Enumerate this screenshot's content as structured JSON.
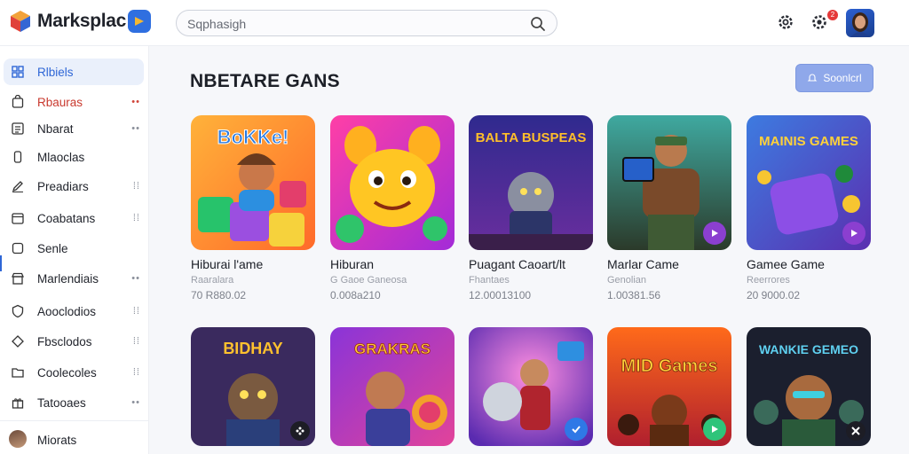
{
  "app": {
    "name": "Marksplac",
    "colors": {
      "accent": "#2e66d6",
      "alert": "#c9392e",
      "cta": "#8fa8ea"
    }
  },
  "search": {
    "placeholder": "Sqphasigh"
  },
  "header": {
    "notification_count": "2",
    "icons": [
      "settings-icon",
      "gear-icon",
      "avatar"
    ]
  },
  "sidebar": {
    "items": [
      {
        "label": "Rlbiels",
        "icon": "grid-icon",
        "active": true,
        "dots": ""
      },
      {
        "label": "Rbauras",
        "icon": "bag-icon",
        "active": false,
        "dots": "••",
        "alert": true
      },
      {
        "label": "Nbarat",
        "icon": "list-icon",
        "active": false,
        "dots": "••"
      },
      {
        "label": "Mlaoclas",
        "icon": "device-icon",
        "active": false,
        "dots": ""
      },
      {
        "label": "Preadiars",
        "icon": "pencil-icon",
        "active": false,
        "dots": "⁞⁞"
      },
      {
        "label": "Coabatans",
        "icon": "calendar-icon",
        "active": false,
        "dots": "⁞⁞"
      },
      {
        "label": "Senle",
        "icon": "square-icon",
        "active": false,
        "dots": ""
      },
      {
        "label": "Marlendiais",
        "icon": "store-icon",
        "active": false,
        "dots": "••"
      },
      {
        "label": "Aooclodios",
        "icon": "shield-icon",
        "active": false,
        "dots": "⁞⁞"
      },
      {
        "label": "Fbsclodos",
        "icon": "diamond-icon",
        "active": false,
        "dots": "⁞⁞"
      },
      {
        "label": "Coolecoles",
        "icon": "folder-icon",
        "active": false,
        "dots": "⁞⁞"
      },
      {
        "label": "Tatooaes",
        "icon": "gift-icon",
        "active": false,
        "dots": "••"
      }
    ],
    "footer": {
      "label": "Miorats"
    }
  },
  "main": {
    "title": "NBETARE GANS",
    "cta_label": "Soonlcrl",
    "cards": [
      {
        "title": "Hiburai l'ame",
        "sub": "Raaralara",
        "stat": "70 R880.02",
        "art_text": "BoKKe!"
      },
      {
        "title": "Hiburan",
        "sub": "G Gaoe Ganeosa",
        "stat": "0.008a210",
        "art_text": ""
      },
      {
        "title": "Puagant Caoart/lt",
        "sub": "Fhantaes",
        "stat": "12.00013100",
        "art_text": "BALTA BUSPEAS"
      },
      {
        "title": "Marlar Came",
        "sub": "Genolian",
        "stat": "1.00381.56",
        "art_text": ""
      },
      {
        "title": "Gamee Game",
        "sub": "Reerrores",
        "stat": "20 9000.02",
        "art_text": "MAINIS GAMES"
      },
      {
        "title": "",
        "sub": "",
        "stat": "",
        "art_text": "BIDHAY"
      },
      {
        "title": "",
        "sub": "",
        "stat": "",
        "art_text": "GRAKRAS"
      },
      {
        "title": "",
        "sub": "",
        "stat": "",
        "art_text": ""
      },
      {
        "title": "",
        "sub": "",
        "stat": "",
        "art_text": "MID Games"
      },
      {
        "title": "",
        "sub": "",
        "stat": "",
        "art_text": "WANKIE GEMEO"
      }
    ]
  }
}
